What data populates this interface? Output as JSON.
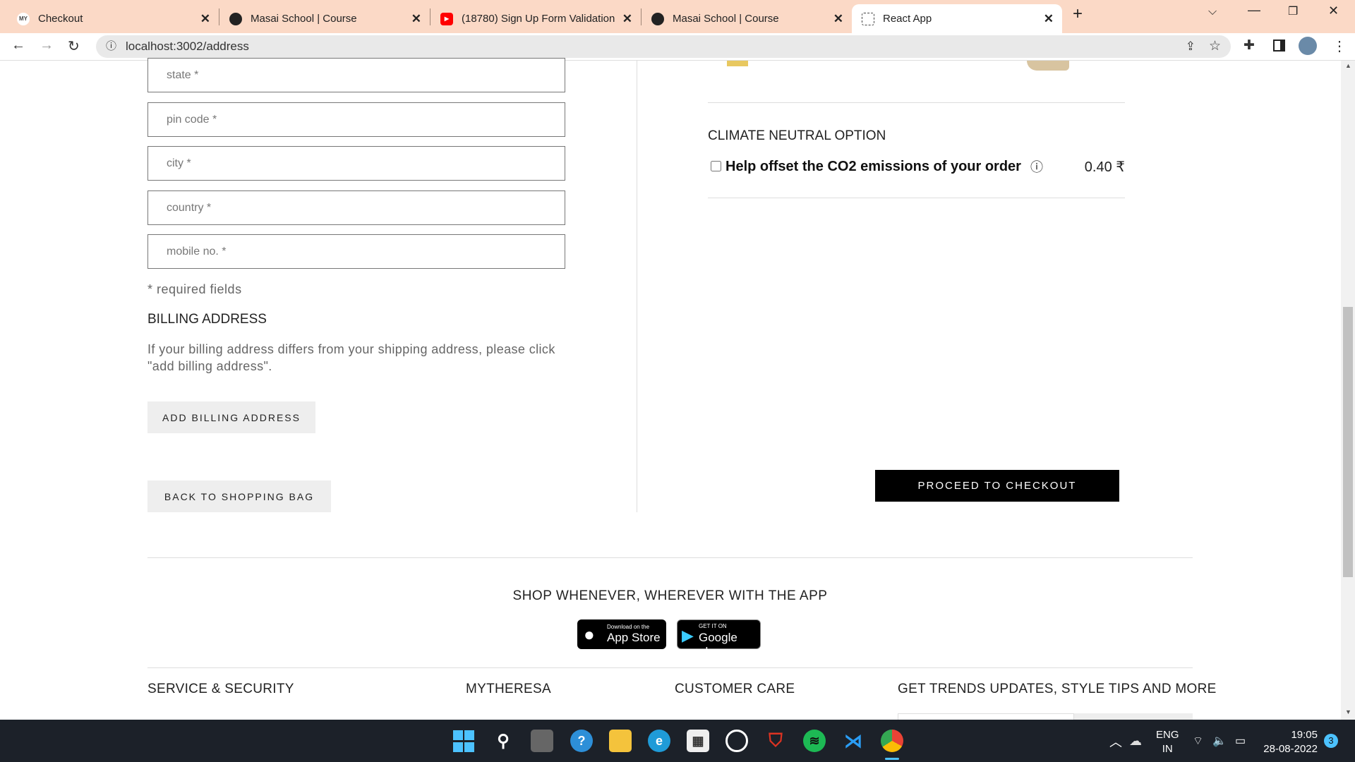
{
  "browser": {
    "tabs": [
      {
        "title": "Checkout",
        "favicon": "MY"
      },
      {
        "title": "Masai School | Course",
        "favicon": "globe-icon"
      },
      {
        "title": "(18780) Sign Up Form Validation",
        "favicon": "youtube-icon"
      },
      {
        "title": "Masai School | Course",
        "favicon": "globe-icon"
      },
      {
        "title": "React App",
        "favicon": "react-icon",
        "active": true
      }
    ],
    "url": "localhost:3002/address"
  },
  "form": {
    "fields": [
      {
        "placeholder": "state *"
      },
      {
        "placeholder": "pin code *"
      },
      {
        "placeholder": "city *"
      },
      {
        "placeholder": "country *"
      },
      {
        "placeholder": "mobile no. *"
      }
    ],
    "required_note": "* required fields",
    "billing_heading": "BILLING ADDRESS",
    "billing_text": "If your billing address differs from your shipping address, please click \"add billing address\".",
    "add_billing_label": "ADD BILLING ADDRESS",
    "back_label": "BACK TO SHOPPING BAG"
  },
  "summary": {
    "climate_heading": "CLIMATE NEUTRAL OPTION",
    "co2_label": "Help offset the CO2 emissions of your order",
    "co2_price": "₹ 0.40",
    "co2_checked": false,
    "checkout_label": "PROCEED TO CHECKOUT"
  },
  "footer": {
    "app_heading": "SHOP WHENEVER, WHEREVER WITH THE APP",
    "appstore_small": "Download on the",
    "appstore_big": "App Store",
    "gplay_small": "GET IT ON",
    "gplay_big": "Google play",
    "columns": [
      "SERVICE & SECURITY",
      "MYTHERESA",
      "CUSTOMER CARE",
      "GET TRENDS UPDATES, STYLE TIPS AND MORE"
    ]
  },
  "taskbar": {
    "lang": "ENG",
    "region": "IN",
    "time": "19:05",
    "date": "28-08-2022",
    "notifications": "3"
  }
}
